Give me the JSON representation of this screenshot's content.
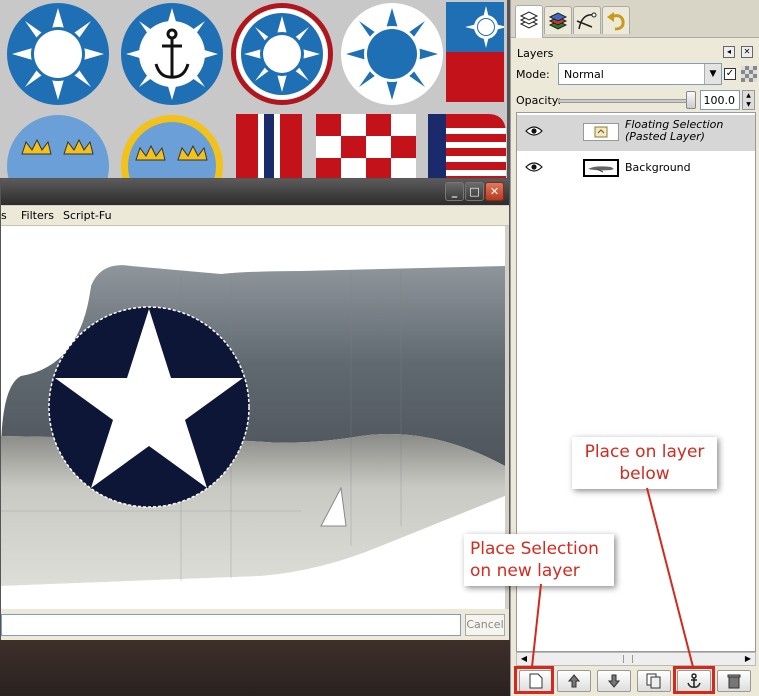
{
  "image_window": {
    "menu": [
      "s",
      "Filters",
      "Script-Fu"
    ],
    "window_buttons": {
      "minimize": "_",
      "maximize": "□",
      "close": "✕"
    },
    "cancel_label": "Cancel"
  },
  "layers_dock": {
    "title": "Layers",
    "mode_label": "Mode:",
    "mode_value": "Normal",
    "opacity_label": "Opacity:",
    "opacity_value": "100.0",
    "layers": [
      {
        "name_line1": "Floating Selection",
        "name_line2": "(Pasted Layer)",
        "selected": true,
        "visible": true
      },
      {
        "name_line1": "Background",
        "name_line2": "",
        "selected": false,
        "visible": true
      }
    ],
    "buttons": [
      "new-layer",
      "raise-layer",
      "lower-layer",
      "duplicate-layer",
      "anchor-layer",
      "delete-layer"
    ]
  },
  "annotations": {
    "anchor_callout": [
      "Place on layer",
      "below"
    ],
    "new_layer_callout": [
      "Place Selection",
      "on new layer"
    ]
  },
  "colors": {
    "roc_blue": "#1f6fb5",
    "annotation_red": "#d42a1e",
    "usn_navy": "#0d1636",
    "swedish_blue": "#6a9fd8",
    "swedish_yellow": "#f2c21a"
  }
}
